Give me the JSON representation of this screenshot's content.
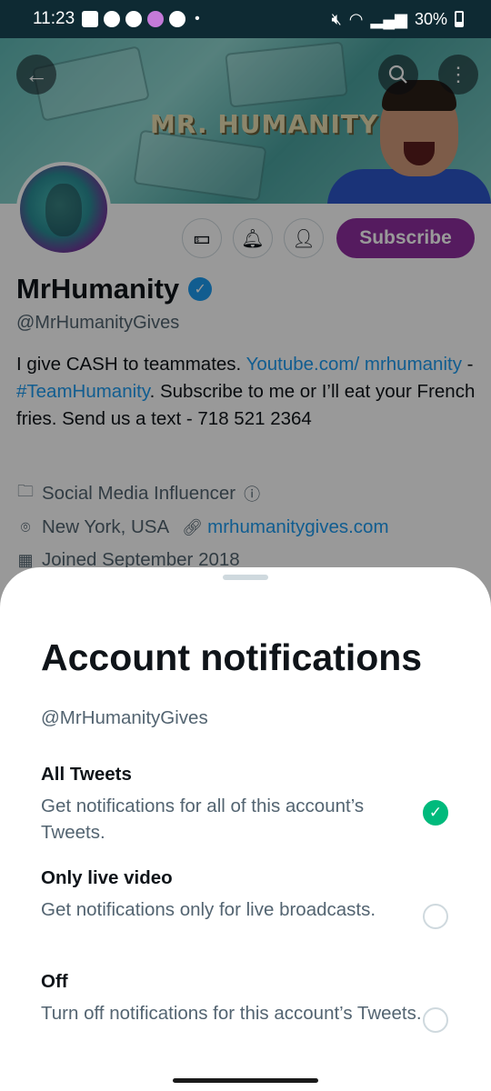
{
  "status_bar": {
    "time": "11:23",
    "battery": "30%"
  },
  "banner": {
    "title": "MR. HUMANITY"
  },
  "profile": {
    "subscribe_label": "Subscribe",
    "display_name": "MrHumanity",
    "handle": "@MrHumanityGives",
    "bio": {
      "text_1": "I give CASH to teammates. ",
      "link_1": "Youtube.com/ mrhumanity",
      "text_2": " - ",
      "hashtag": "#TeamHumanity",
      "text_3": ". Subscribe to me or I’ll eat your French fries. Send us a text - 718 521 2364"
    },
    "category": "Social Media Influencer",
    "location": "New York, USA",
    "website": "mrhumanitygives.com",
    "joined": "Joined September 2018"
  },
  "sheet": {
    "title": "Account notifications",
    "handle": "@MrHumanityGives",
    "options": [
      {
        "title": "All Tweets",
        "description": "Get notifications for all of this account’s Tweets.",
        "selected": true
      },
      {
        "title": "Only live video",
        "description": "Get notifications only for live broadcasts.",
        "selected": false
      },
      {
        "title": "Off",
        "description": "Turn off notifications for this account’s Tweets.",
        "selected": false
      }
    ]
  },
  "icons": {
    "back": "arrow-left-icon",
    "search": "search-icon",
    "more": "more-vertical-icon",
    "tip": "money-icon",
    "notify": "bell-check-icon",
    "follow": "person-check-icon",
    "verified": "verified-badge-icon",
    "category": "briefcase-icon",
    "info": "info-icon",
    "location": "location-pin-icon",
    "link": "link-icon",
    "calendar": "calendar-icon",
    "check": "check-icon"
  },
  "colors": {
    "accent_blue": "#1d9bf0",
    "subscribe_purple": "#8e2e9e",
    "selected_green": "#00ba7c",
    "status_bar_bg": "#0e2a33"
  }
}
